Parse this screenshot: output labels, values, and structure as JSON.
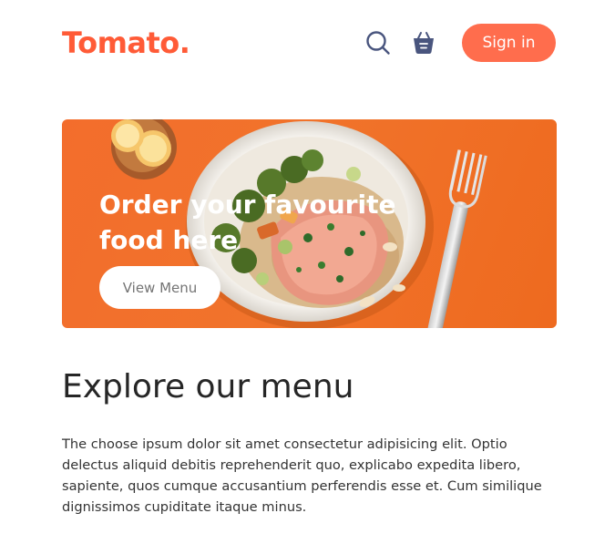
{
  "navbar": {
    "logo": "Tomato.",
    "search_icon": "search-icon",
    "basket_icon": "basket-icon",
    "signin_label": "Sign in"
  },
  "hero": {
    "title": "Order your favourite food here",
    "button_label": "View Menu"
  },
  "explore": {
    "title": "Explore our menu",
    "text": "The choose ipsum dolor sit amet consectetur adipisicing elit. Optio delectus aliquid debitis reprehenderit quo, explicabo expedita libero, sapiente, quos cumque accusantium perferendis esse et. Cum similique dignissimos cupiditate itaque minus."
  },
  "colors": {
    "brand": "#ff5b37",
    "signin_bg": "#ff6d4d",
    "hero_bg": "#f1732b",
    "icon": "#49557e"
  }
}
